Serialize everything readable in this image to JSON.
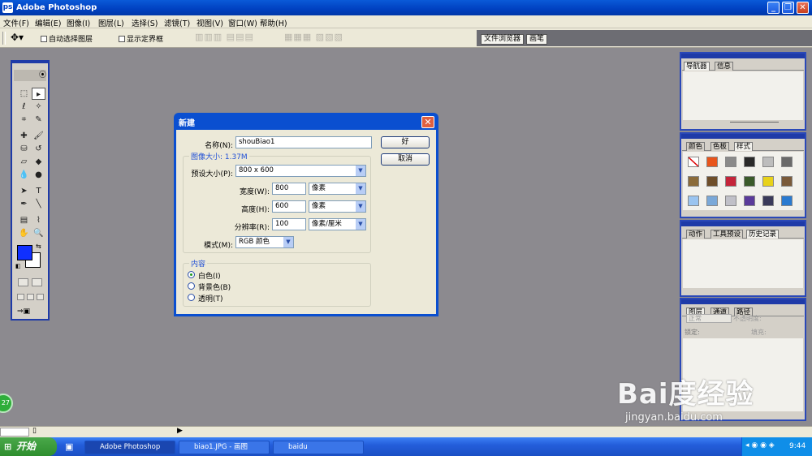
{
  "window": {
    "title": "Adobe Photoshop",
    "app_icon_glyph": "ps"
  },
  "menu": [
    "文件(F)",
    "编辑(E)",
    "图像(I)",
    "图层(L)",
    "选择(S)",
    "滤镜(T)",
    "视图(V)",
    "窗口(W)",
    "帮助(H)"
  ],
  "options": {
    "auto_select": "自动选择图层",
    "show_bounds": "显示定界框",
    "tabs": [
      "文件浏览器",
      "画笔"
    ]
  },
  "panels": {
    "navigator": {
      "tabs": [
        "导航器",
        "信息"
      ]
    },
    "swatches": {
      "tabs": [
        "颜色",
        "色板",
        "样式"
      ]
    },
    "history": {
      "tabs": [
        "动作",
        "工具预设",
        "历史记录"
      ]
    },
    "layers": {
      "tabs": [
        "图层",
        "通道",
        "路径"
      ],
      "blend_mode": "正常",
      "opacity_label": "不透明度:",
      "lock_label": "锁定:",
      "fill_label": "填充:"
    }
  },
  "dialog": {
    "title": "新建",
    "name_label": "名称(N):",
    "name_value": "shouBiao1",
    "ok": "好",
    "cancel": "取消",
    "image_size_label": "图像大小: 1.37M",
    "preset_label": "预设大小(P):",
    "preset_value": "800 x 600",
    "width_label": "宽度(W):",
    "width_value": "800",
    "width_unit": "像素",
    "height_label": "高度(H):",
    "height_value": "600",
    "height_unit": "像素",
    "resolution_label": "分辨率(R):",
    "resolution_value": "100",
    "resolution_unit": "像素/厘米",
    "mode_label": "模式(M):",
    "mode_value": "RGB 颜色",
    "content_label": "内容",
    "content_options": [
      "白色(I)",
      "背景色(B)",
      "透明(T)"
    ],
    "content_selected": 0
  },
  "taskbar": {
    "start": "开始",
    "items": [
      "Adobe Photoshop",
      "biao1.JPG - 画图",
      "baidu"
    ],
    "clock": "9:44"
  },
  "watermark": {
    "brand": "Bai度经验",
    "url": "jingyan.baidu.com"
  },
  "badge": "27"
}
